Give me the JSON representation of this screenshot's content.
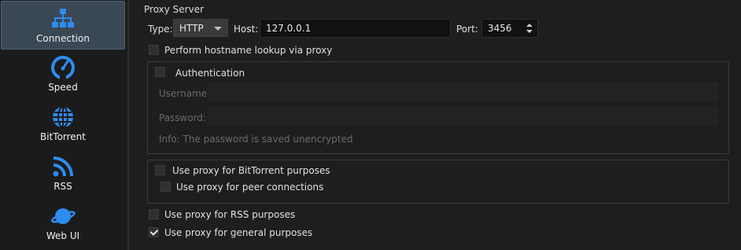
{
  "sidebar": {
    "items": [
      {
        "label": "Connection",
        "icon": "network-icon",
        "active": true
      },
      {
        "label": "Speed",
        "icon": "speedometer-icon",
        "active": false
      },
      {
        "label": "BitTorrent",
        "icon": "globe-icon",
        "active": false
      },
      {
        "label": "RSS",
        "icon": "rss-icon",
        "active": false
      },
      {
        "label": "Web UI",
        "icon": "planet-icon",
        "active": false
      }
    ]
  },
  "proxy": {
    "section_title": "Proxy Server",
    "type_label": "Type:",
    "type_value": "HTTP",
    "host_label": "Host:",
    "host_value": "127.0.0.1",
    "port_label": "Port:",
    "port_value": "3456",
    "hostname_lookup_label": "Perform hostname lookup via proxy",
    "hostname_lookup_checked": false,
    "auth": {
      "label": "Authentication",
      "checked": false,
      "username_label": "Username:",
      "password_label": "Password:",
      "info_text": "Info: The password is saved unencrypted"
    },
    "bittorrent_label": "Use proxy for BitTorrent purposes",
    "bittorrent_checked": false,
    "peer_label": "Use proxy for peer connections",
    "peer_checked": false,
    "rss_label": "Use proxy for RSS purposes",
    "rss_checked": false,
    "general_label": "Use proxy for general purposes",
    "general_checked": true
  },
  "colors": {
    "accent": "#2d8cf0",
    "active_bg": "#3a4754"
  }
}
